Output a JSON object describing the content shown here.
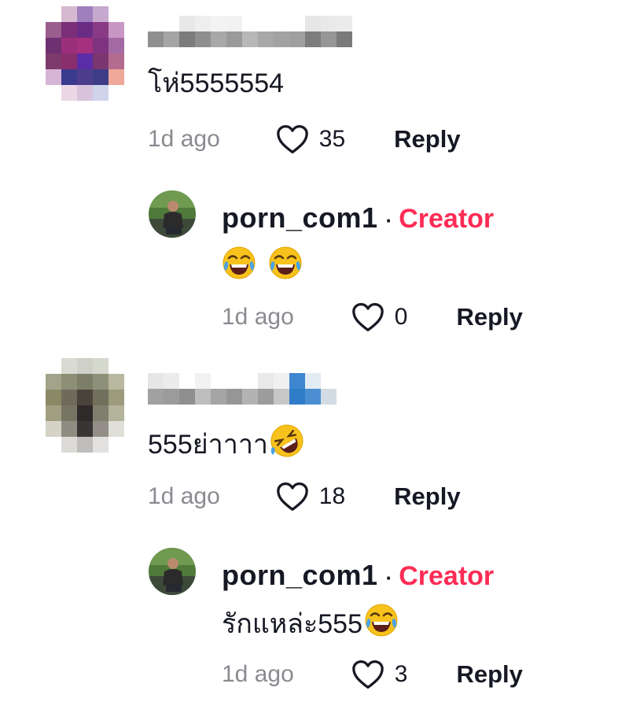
{
  "colors": {
    "creator_accent": "#fe2c55",
    "text": "#161823",
    "muted": "#8a8b91"
  },
  "icons": {
    "like": "heart-outline-icon",
    "joy": "face-with-tears-of-joy-emoji",
    "rofl": "rolling-on-the-floor-laughing-emoji"
  },
  "comments": [
    {
      "text": "โห่5555554",
      "time": "1d ago",
      "likes": "35",
      "reply_label": "Reply",
      "reply": {
        "username": "porn_com1",
        "separator": "·",
        "badge": "Creator",
        "text": "",
        "time": "1d ago",
        "likes": "0",
        "reply_label": "Reply"
      }
    },
    {
      "text": "555ย่าาาา",
      "time": "1d ago",
      "likes": "18",
      "reply_label": "Reply",
      "reply": {
        "username": "porn_com1",
        "separator": "·",
        "badge": "Creator",
        "text": "รักแหล่ะ555",
        "time": "1d ago",
        "likes": "3",
        "reply_label": "Reply"
      }
    }
  ]
}
